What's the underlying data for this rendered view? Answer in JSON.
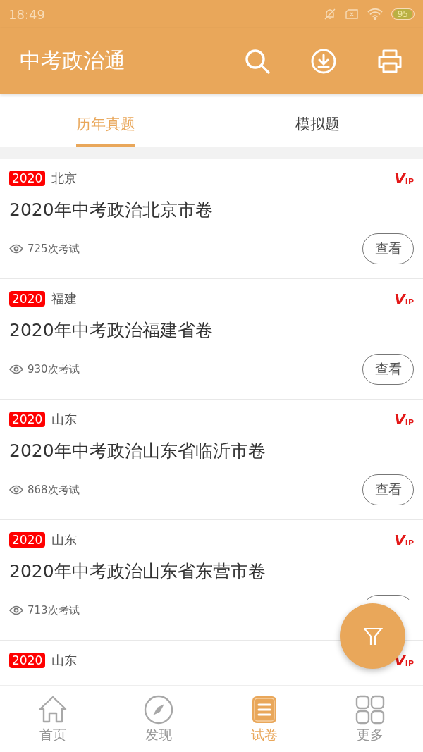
{
  "status_bar": {
    "time": "18:49",
    "battery": "95"
  },
  "app_bar": {
    "title": "中考政治通"
  },
  "tabs": [
    {
      "label": "历年真题",
      "selected": true
    },
    {
      "label": "模拟题",
      "selected": false
    }
  ],
  "papers": [
    {
      "year": "2020",
      "region": "北京",
      "vip": {
        "v": "V",
        "ip": "IP"
      },
      "title": "2020年中考政治北京市卷",
      "views": "725次考试",
      "action": "查看"
    },
    {
      "year": "2020",
      "region": "福建",
      "vip": {
        "v": "V",
        "ip": "IP"
      },
      "title": "2020年中考政治福建省卷",
      "views": "930次考试",
      "action": "查看"
    },
    {
      "year": "2020",
      "region": "山东",
      "vip": {
        "v": "V",
        "ip": "IP"
      },
      "title": "2020年中考政治山东省临沂市卷",
      "views": "868次考试",
      "action": "查看"
    },
    {
      "year": "2020",
      "region": "山东",
      "vip": {
        "v": "V",
        "ip": "IP"
      },
      "title": "2020年中考政治山东省东营市卷",
      "views": "713次考试",
      "action_button": true
    },
    {
      "year": "2020",
      "region": "山东",
      "vip": {
        "v": "V",
        "ip": "IP"
      }
    }
  ],
  "bottom_nav": [
    {
      "label": "首页",
      "kind": "home",
      "selected": false
    },
    {
      "label": "发现",
      "kind": "compass",
      "selected": false
    },
    {
      "label": "试卷",
      "kind": "paper",
      "selected": true
    },
    {
      "label": "更多",
      "kind": "grid",
      "selected": false
    }
  ]
}
